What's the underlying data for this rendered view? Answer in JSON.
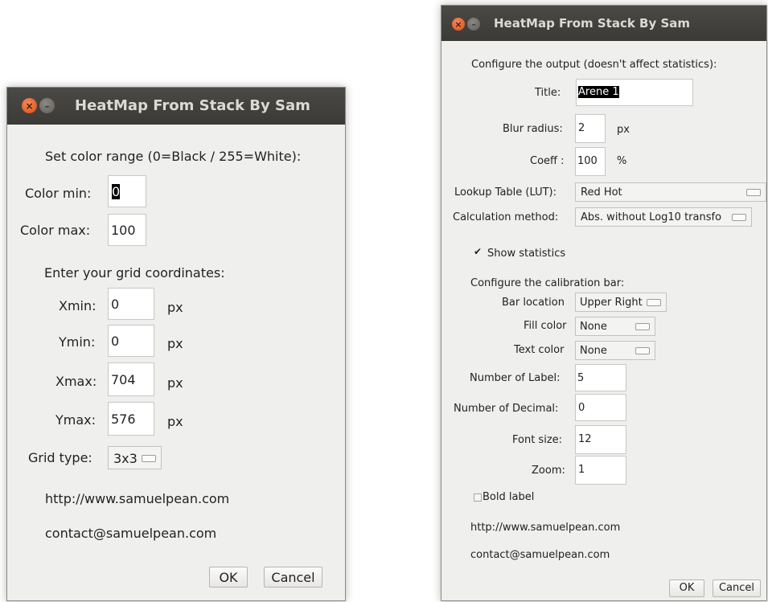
{
  "dialog1": {
    "title": "HeatMap From Stack By Sam",
    "color_range_heading": "Set color range (0=Black / 255=White):",
    "color_min_label": "Color min:",
    "color_min_value": "0",
    "color_max_label": "Color max:",
    "color_max_value": "100",
    "grid_heading": "Enter your grid coordinates:",
    "xmin_label": "Xmin:",
    "xmin_value": "0",
    "ymin_label": "Ymin:",
    "ymin_value": "0",
    "xmax_label": "Xmax:",
    "xmax_value": "704",
    "ymax_label": "Ymax:",
    "ymax_value": "576",
    "unit": "px",
    "grid_type_label": "Grid type:",
    "grid_type_value": "3x3",
    "website": "http://www.samuelpean.com",
    "email": "contact@samuelpean.com",
    "ok": "OK",
    "cancel": "Cancel"
  },
  "dialog2": {
    "title": "HeatMap From Stack By Sam",
    "output_heading": "Configure the output (doesn't affect statistics):",
    "title_label": "Title:",
    "title_value": "Arene 1",
    "blur_label": "Blur radius:",
    "blur_value": "2",
    "blur_unit": "px",
    "coeff_label": "Coeff :",
    "coeff_value": "100",
    "coeff_unit": "%",
    "lut_label": "Lookup Table (LUT):",
    "lut_value": "Red Hot",
    "calc_label": "Calculation method:",
    "calc_value": "Abs. without Log10 transfo",
    "show_stats_label": "Show statistics",
    "show_stats_checked": true,
    "calib_heading": "Configure the calibration bar:",
    "bar_location_label": "Bar location",
    "bar_location_value": "Upper Right",
    "fill_color_label": "Fill color",
    "fill_color_value": "None",
    "text_color_label": "Text color",
    "text_color_value": "None",
    "num_label_label": "Number of Label:",
    "num_label_value": "5",
    "num_decimal_label": "Number of Decimal:",
    "num_decimal_value": "0",
    "font_size_label": "Font size:",
    "font_size_value": "12",
    "zoom_label": "Zoom:",
    "zoom_value": "1",
    "bold_label": "Bold label",
    "bold_checked": false,
    "website": "http://www.samuelpean.com",
    "email": "contact@samuelpean.com",
    "ok": "OK",
    "cancel": "Cancel"
  },
  "icons": {
    "close": "close-icon",
    "minimize": "minimize-icon",
    "dropdown": "chevron-down-icon"
  },
  "colors": {
    "titlebar": "#3f3e3a",
    "close_button": "#e65a24",
    "window_bg": "#efefee"
  }
}
